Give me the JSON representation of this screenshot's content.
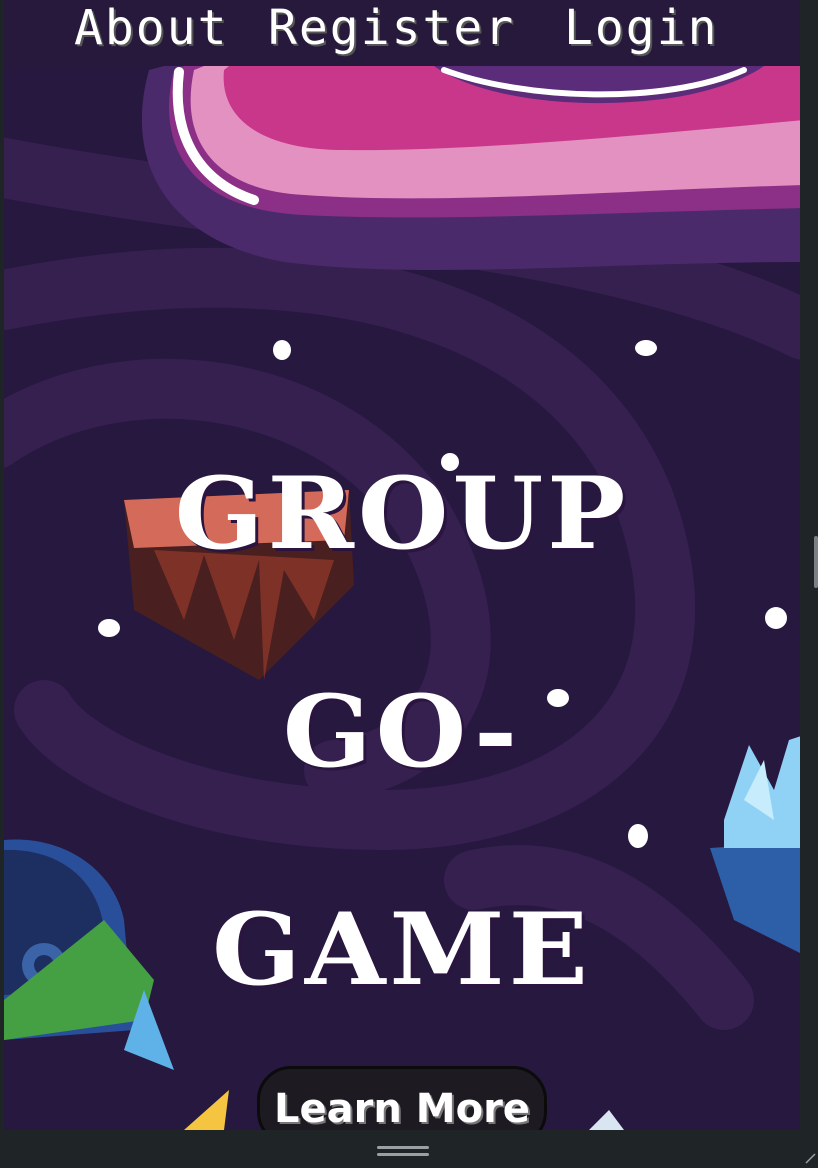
{
  "nav": {
    "items": [
      {
        "label": "About"
      },
      {
        "label": "Register"
      },
      {
        "label": "Login"
      }
    ]
  },
  "hero": {
    "title_lines": [
      "GROUP",
      "GO-",
      "GAME"
    ],
    "cta_label": "Learn More"
  },
  "colors": {
    "background": "#27183f",
    "nav_background": "#26193b",
    "planet_pink": "#c83a8a",
    "text": "#ffffff"
  },
  "icons": {
    "drag_handle": "drag-handle-icon",
    "resize": "resize-corner-icon"
  }
}
